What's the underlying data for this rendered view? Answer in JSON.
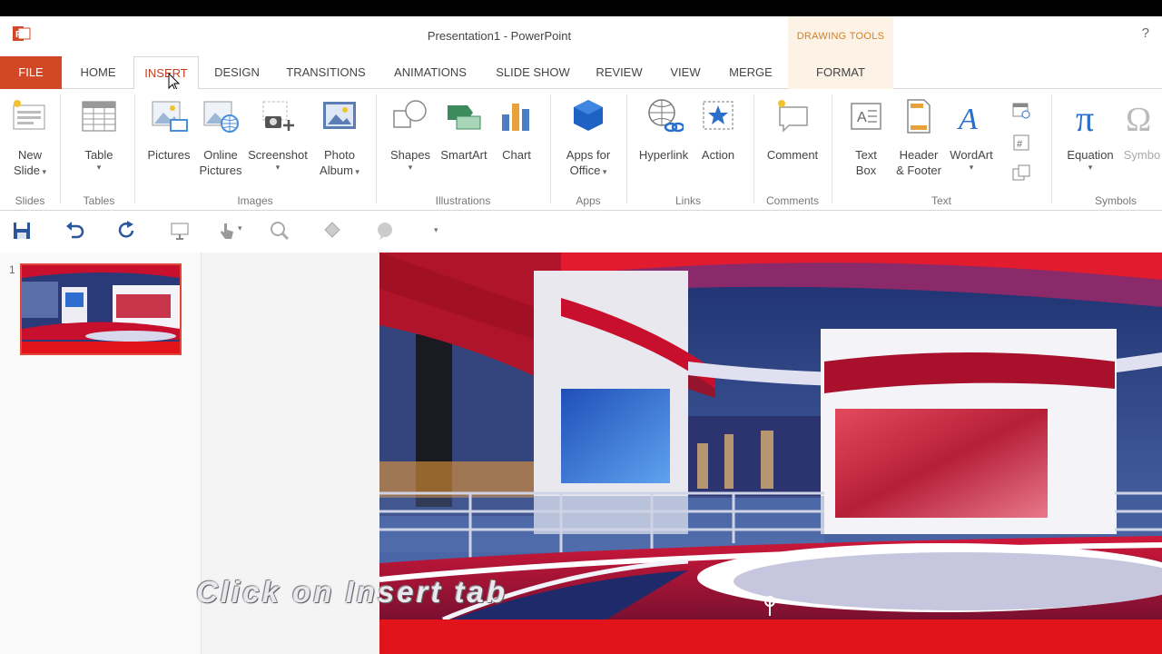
{
  "window": {
    "title": "Presentation1 - PowerPoint",
    "contextual_group": "DRAWING TOOLS",
    "help_label": "?"
  },
  "tabs": [
    {
      "label": "FILE"
    },
    {
      "label": "HOME"
    },
    {
      "label": "INSERT"
    },
    {
      "label": "DESIGN"
    },
    {
      "label": "TRANSITIONS"
    },
    {
      "label": "ANIMATIONS"
    },
    {
      "label": "SLIDE SHOW"
    },
    {
      "label": "REVIEW"
    },
    {
      "label": "VIEW"
    },
    {
      "label": "MERGE"
    },
    {
      "label": "FORMAT"
    }
  ],
  "active_tab": "INSERT",
  "ribbon": {
    "slides": {
      "label": "Slides",
      "new_slide": [
        "New",
        "Slide"
      ]
    },
    "tables": {
      "label": "Tables",
      "table": "Table"
    },
    "images": {
      "label": "Images",
      "pictures": "Pictures",
      "online_pictures": [
        "Online",
        "Pictures"
      ],
      "screenshot": "Screenshot",
      "photo_album": [
        "Photo",
        "Album"
      ]
    },
    "illustrations": {
      "label": "Illustrations",
      "shapes": "Shapes",
      "smartart": "SmartArt",
      "chart": "Chart"
    },
    "apps": {
      "label": "Apps",
      "apps_for_office": [
        "Apps for",
        "Office"
      ]
    },
    "links": {
      "label": "Links",
      "hyperlink": "Hyperlink",
      "action": "Action"
    },
    "comments": {
      "label": "Comments",
      "comment": "Comment"
    },
    "text": {
      "label": "Text",
      "text_box": [
        "Text",
        "Box"
      ],
      "header_footer": [
        "Header",
        "& Footer"
      ],
      "wordart": "WordArt"
    },
    "symbols": {
      "label": "Symbols",
      "equation": "Equation",
      "symbol": "Symbo"
    }
  },
  "thumbnails": [
    {
      "number": "1"
    }
  ],
  "caption": "Click on Insert tab",
  "colors": {
    "file_tab": "#d24726",
    "accent": "#c43e1c",
    "thumb_border": "#e0463a",
    "drawing_tools": "#d0822a"
  }
}
